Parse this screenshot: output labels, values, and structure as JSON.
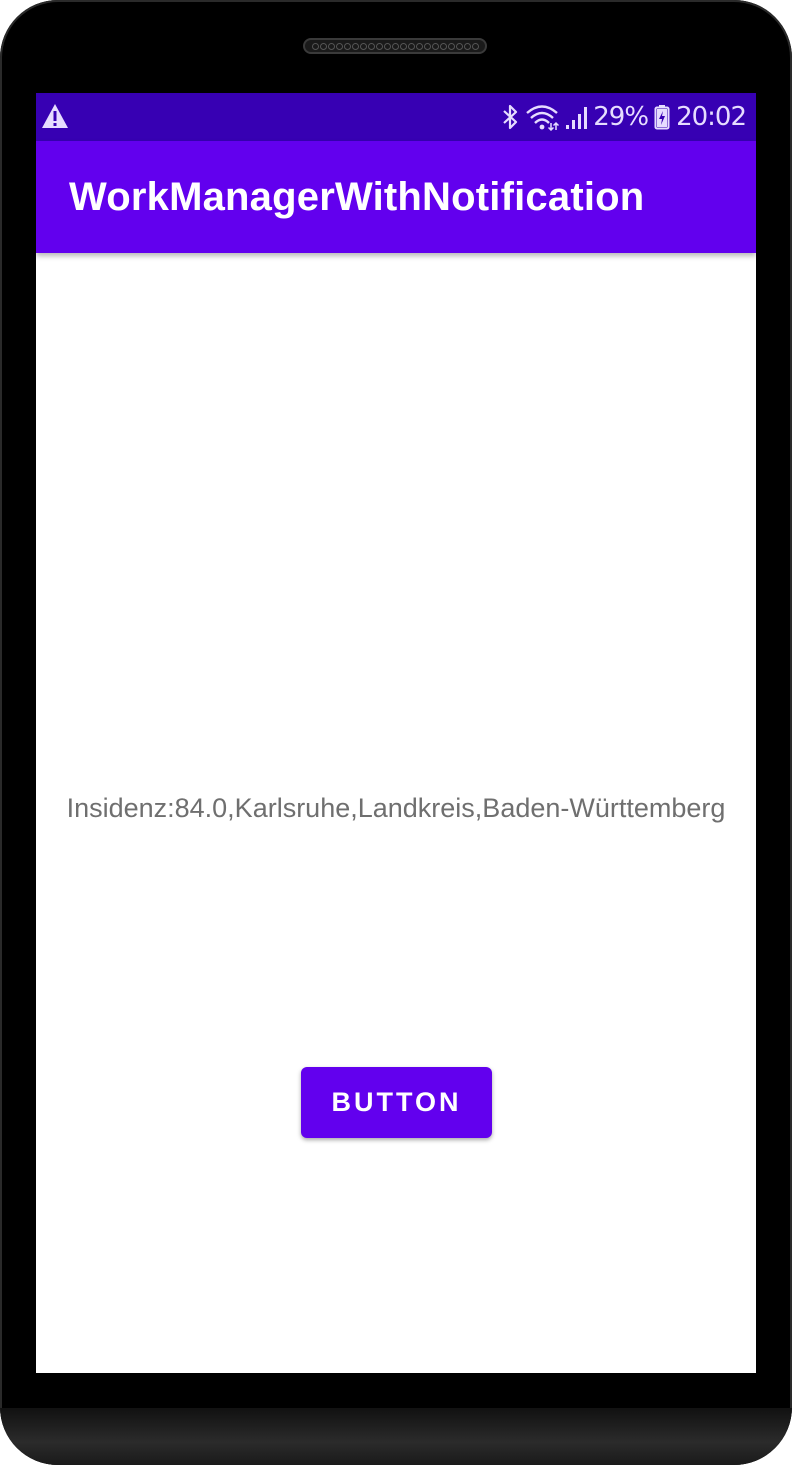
{
  "status_bar": {
    "warning_icon": "warning-triangle-icon",
    "bluetooth_icon": "bluetooth-icon",
    "wifi_icon": "wifi-icon",
    "signal_icon": "cell-signal-icon",
    "battery_icon": "battery-charging-icon",
    "battery_percent": "29%",
    "time": "20:02"
  },
  "app_bar": {
    "title": "WorkManagerWithNotification"
  },
  "main": {
    "info_text": "Insidenz:84.0,Karlsruhe,Landkreis,Baden-Württemberg",
    "button_label": "BUTTON"
  },
  "colors": {
    "status_bar": "#3700b3",
    "primary": "#6200ee",
    "text_secondary": "#6f6f6f"
  }
}
